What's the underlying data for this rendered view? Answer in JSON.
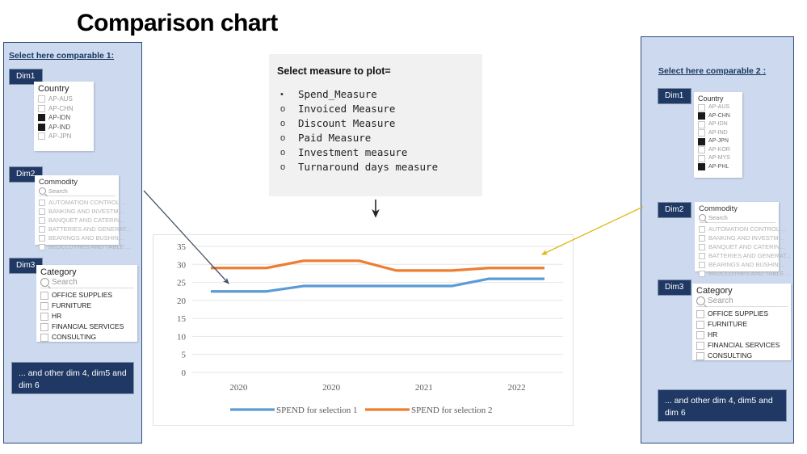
{
  "page": {
    "title": "Comparison chart"
  },
  "left_panel": {
    "heading": "Select here comparable 1:",
    "dim1_badge": "Dim1",
    "dim2_badge": "Dim2",
    "dim3_badge": "Dim3",
    "note": "... and other dim 4, dim5 and dim 6",
    "country_slicer": {
      "title": "Country",
      "options": [
        {
          "label": "AP-AUS",
          "checked": false
        },
        {
          "label": "AP-CHN",
          "checked": false
        },
        {
          "label": "AP-IDN",
          "checked": true
        },
        {
          "label": "AP-IND",
          "checked": true
        },
        {
          "label": "AP-JPN",
          "checked": false
        }
      ]
    },
    "commodity_slicer": {
      "title": "Commodity",
      "search_placeholder": "Search",
      "options": [
        {
          "label": "AUTOMATION CONTROL ...",
          "checked": false
        },
        {
          "label": "BANKING AND INVESTM...",
          "checked": false
        },
        {
          "label": "BANQUET AND CATERIN...",
          "checked": false
        },
        {
          "label": "BATTERIES AND GENERAT...",
          "checked": false
        },
        {
          "label": "BEARINGS AND BUSHIN...",
          "checked": false
        },
        {
          "label": "BEDCLOTHES AND TABLE ...",
          "checked": false
        }
      ]
    },
    "category_slicer": {
      "title": "Category",
      "search_placeholder": "Search",
      "options": [
        {
          "label": "OFFICE SUPPLIES",
          "checked": false
        },
        {
          "label": "FURNITURE",
          "checked": false
        },
        {
          "label": "HR",
          "checked": false
        },
        {
          "label": "FINANCIAL SERVICES",
          "checked": false
        },
        {
          "label": "CONSULTING",
          "checked": false
        }
      ]
    }
  },
  "right_panel": {
    "heading": "Select here comparable 2 :",
    "dim1_badge": "Dim1",
    "dim2_badge": "Dim2",
    "dim3_badge": "Dim3",
    "note": "... and other dim 4, dim5 and dim 6",
    "country_slicer": {
      "title": "Country",
      "options": [
        {
          "label": "AP-AUS",
          "checked": false
        },
        {
          "label": "AP-CHN",
          "checked": true
        },
        {
          "label": "AP-IDN",
          "checked": false
        },
        {
          "label": "AP-IND",
          "checked": false
        },
        {
          "label": "AP-JPN",
          "checked": true
        },
        {
          "label": "AP-KOR",
          "checked": false
        },
        {
          "label": "AP-MYS",
          "checked": false
        },
        {
          "label": "AP-PHL",
          "checked": true
        }
      ]
    },
    "commodity_slicer": {
      "title": "Commodity",
      "search_placeholder": "Search",
      "options": [
        {
          "label": "AUTOMATION CONTROL ...",
          "checked": false
        },
        {
          "label": "BANKING AND INVESTM...",
          "checked": false
        },
        {
          "label": "BANQUET AND CATERIN...",
          "checked": false
        },
        {
          "label": "BATTERIES AND GENERAT...",
          "checked": false
        },
        {
          "label": "BEARINGS AND BUSHIN...",
          "checked": false
        },
        {
          "label": "BEDCLOTHES AND TABLE ...",
          "checked": false
        }
      ]
    },
    "category_slicer": {
      "title": "Category",
      "search_placeholder": "Search",
      "options": [
        {
          "label": "OFFICE SUPPLIES",
          "checked": false
        },
        {
          "label": "FURNITURE",
          "checked": false
        },
        {
          "label": "HR",
          "checked": false
        },
        {
          "label": "FINANCIAL SERVICES",
          "checked": false
        },
        {
          "label": "CONSULTING",
          "checked": false
        }
      ]
    }
  },
  "measure_box": {
    "title": "Select measure to plot=",
    "options": [
      {
        "bullet": "•",
        "label": "Spend_Measure",
        "selected": true
      },
      {
        "bullet": "o",
        "label": "Invoiced Measure",
        "selected": false
      },
      {
        "bullet": "o",
        "label": "Discount Measure",
        "selected": false
      },
      {
        "bullet": "o",
        "label": "Paid Measure",
        "selected": false
      },
      {
        "bullet": "o",
        "label": "Investment measure",
        "selected": false
      },
      {
        "bullet": "o",
        "label": "Turnaround days measure",
        "selected": false
      }
    ]
  },
  "colors": {
    "series1": "#5b9bd5",
    "series2": "#ed7d31",
    "panel_fill": "#ccd9ee",
    "panel_border": "#2f4e79",
    "badge_navy": "#1f3864",
    "arrow_blue": "#44546a",
    "arrow_gold": "#e0b711",
    "arrow_black": "#262626",
    "gridline": "#e6e6e6"
  },
  "chart_data": {
    "type": "line",
    "title": "",
    "xlabel": "",
    "ylabel": "",
    "categories": [
      "2020",
      "2020",
      "2021",
      "2022"
    ],
    "ylim": [
      0,
      35
    ],
    "yticks": [
      0,
      5,
      10,
      15,
      20,
      25,
      30,
      35
    ],
    "grid": true,
    "legend_position": "bottom",
    "series": [
      {
        "name": "SPEND for selection 1",
        "color": "#5b9bd5",
        "values": [
          22.5,
          24.0,
          24.0,
          26.0
        ]
      },
      {
        "name": "SPEND for selection 2",
        "color": "#ed7d31",
        "values": [
          29.0,
          31.0,
          28.3,
          29.0
        ]
      }
    ]
  }
}
